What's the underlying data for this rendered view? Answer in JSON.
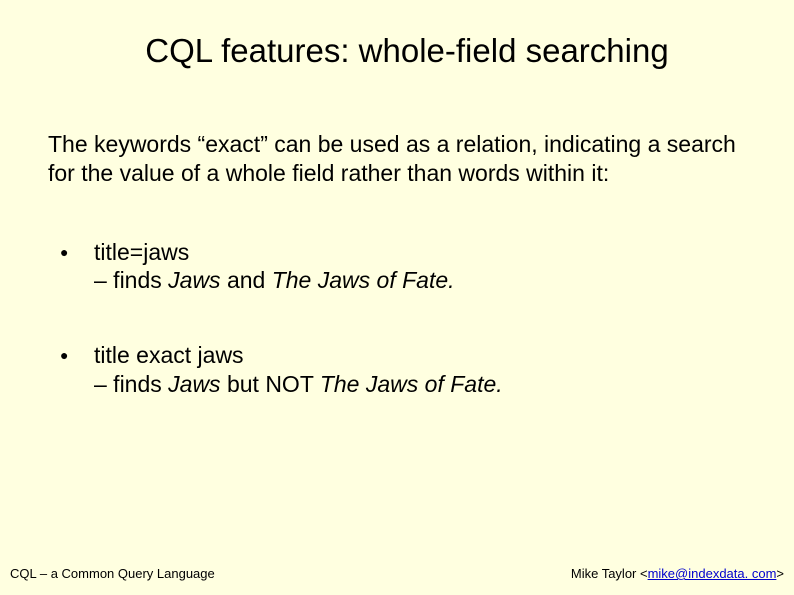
{
  "title": "CQL features: whole-field searching",
  "intro": "The keywords “exact” can be used as a relation, indicating a search for the value of a whole field rather than words within it:",
  "examples": [
    {
      "query": "title=jaws",
      "result_prefix": "– finds ",
      "result_italic1": "Jaws",
      "result_mid": " and ",
      "result_italic2": "The Jaws of Fate.",
      "result_suffix": ""
    },
    {
      "query": "title exact jaws",
      "result_prefix": "– finds ",
      "result_italic1": "Jaws",
      "result_mid": " but NOT ",
      "result_italic2": "The Jaws of Fate.",
      "result_suffix": ""
    }
  ],
  "footer": {
    "left": "CQL – a Common Query Language",
    "right_prefix": "Mike Taylor <",
    "right_link": "mike@indexdata. com",
    "right_suffix": ">"
  }
}
